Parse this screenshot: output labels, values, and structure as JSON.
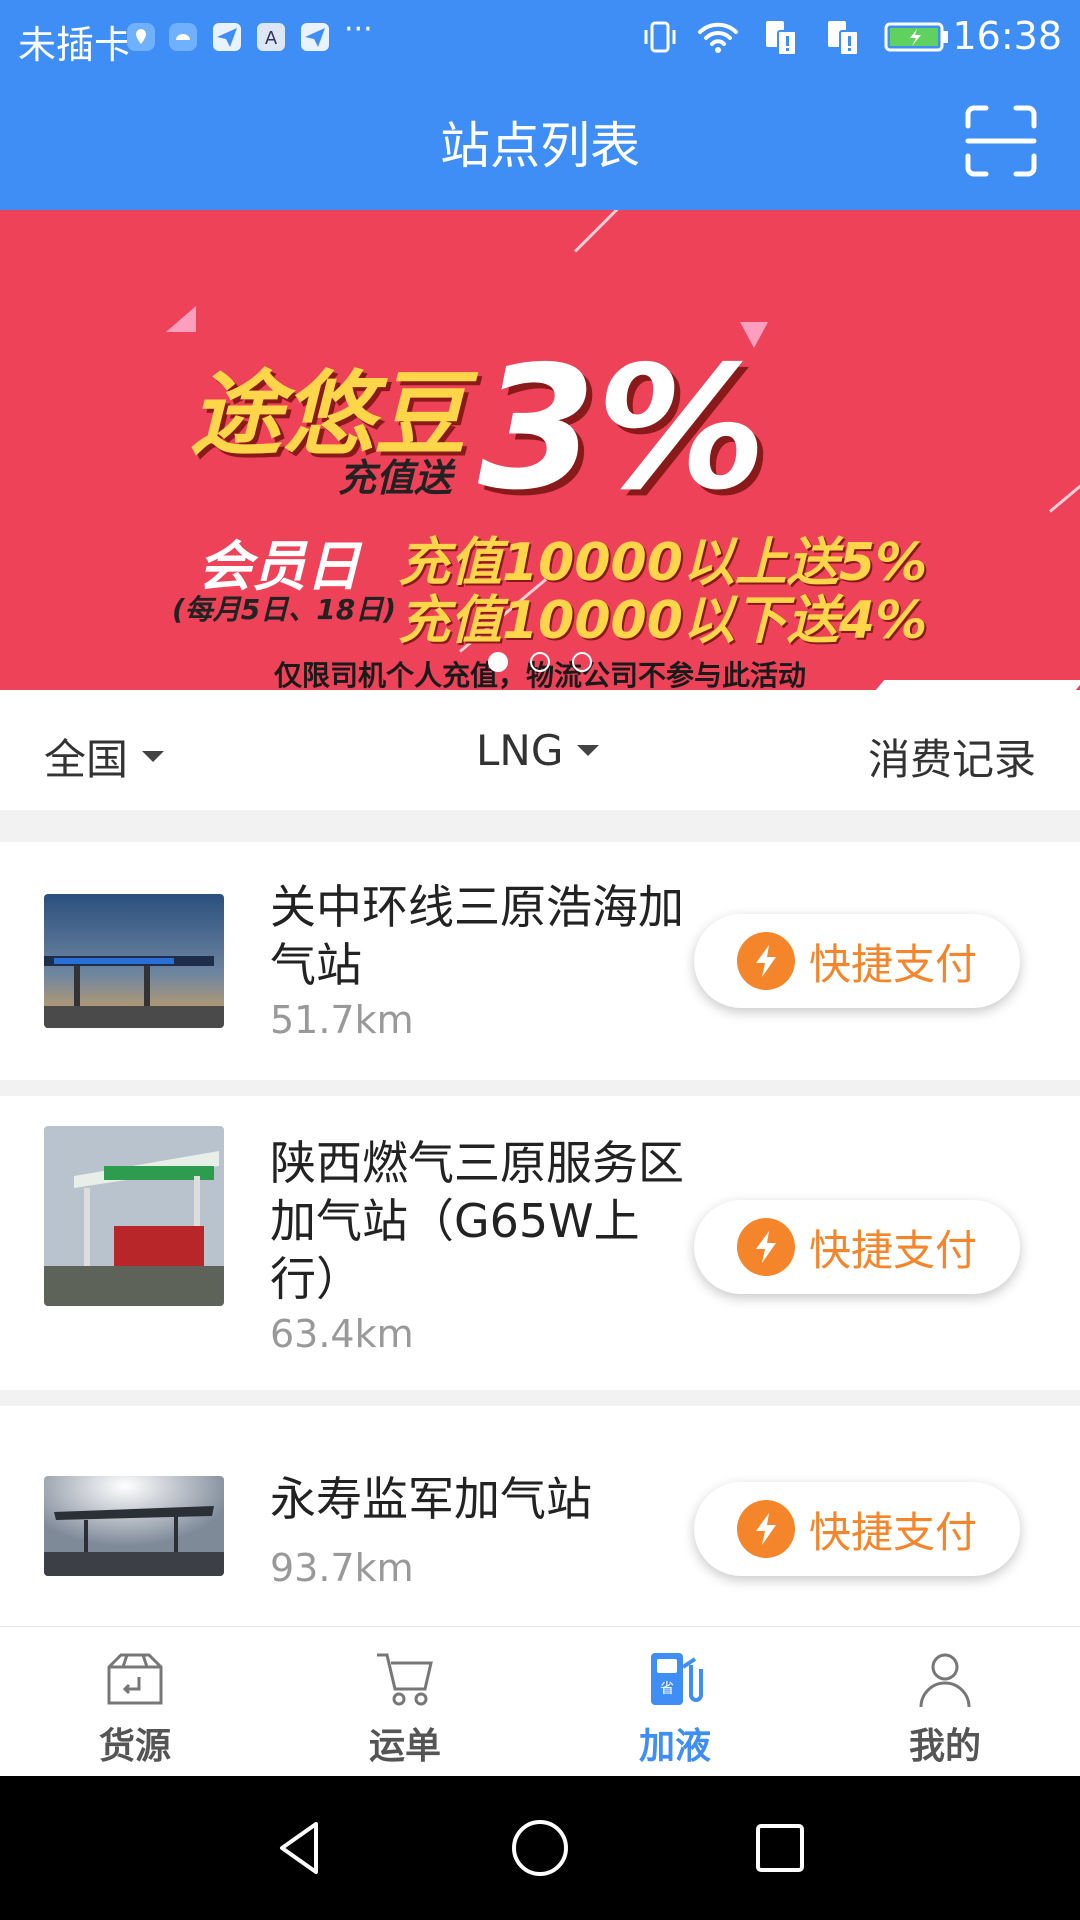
{
  "status_bar": {
    "carrier": "未插卡",
    "more": "···",
    "time": "16:38"
  },
  "header": {
    "title": "站点列表",
    "scan_icon": "scan-icon"
  },
  "banner": {
    "brand": "途悠豆",
    "sub": "充值送",
    "percent": "3%",
    "member_day": "会员日",
    "member_dates": "(每月5日、18日)",
    "offer_1": "充值10000以上送5%",
    "offer_2": "充值10000以下送4%",
    "note": "仅限司机个人充值，物流公司不参与此活动",
    "active_slide": 0,
    "slide_count": 3
  },
  "filters": {
    "region": "全国",
    "fuel_type": "LNG",
    "records": "消费记录"
  },
  "stations": [
    {
      "name": "关中环线三原浩海加气站",
      "distance": "51.7km",
      "pay_label": "快捷支付"
    },
    {
      "name": "陕西燃气三原服务区加气站（G65W上行）",
      "distance": "63.4km",
      "pay_label": "快捷支付"
    },
    {
      "name": "永寿监军加气站",
      "distance": "93.7km",
      "pay_label": "快捷支付"
    }
  ],
  "bottom_nav": {
    "items": [
      {
        "label": "货源",
        "icon": "box-icon",
        "active": false
      },
      {
        "label": "运单",
        "icon": "cart-icon",
        "active": false
      },
      {
        "label": "加液",
        "icon": "fuel-pump-icon",
        "active": true
      },
      {
        "label": "我的",
        "icon": "person-icon",
        "active": false
      }
    ]
  },
  "colors": {
    "primary": "#3f8ef5",
    "banner_bg": "#ee4259",
    "accent_orange": "#f5852a",
    "inactive_nav": "#666666"
  }
}
